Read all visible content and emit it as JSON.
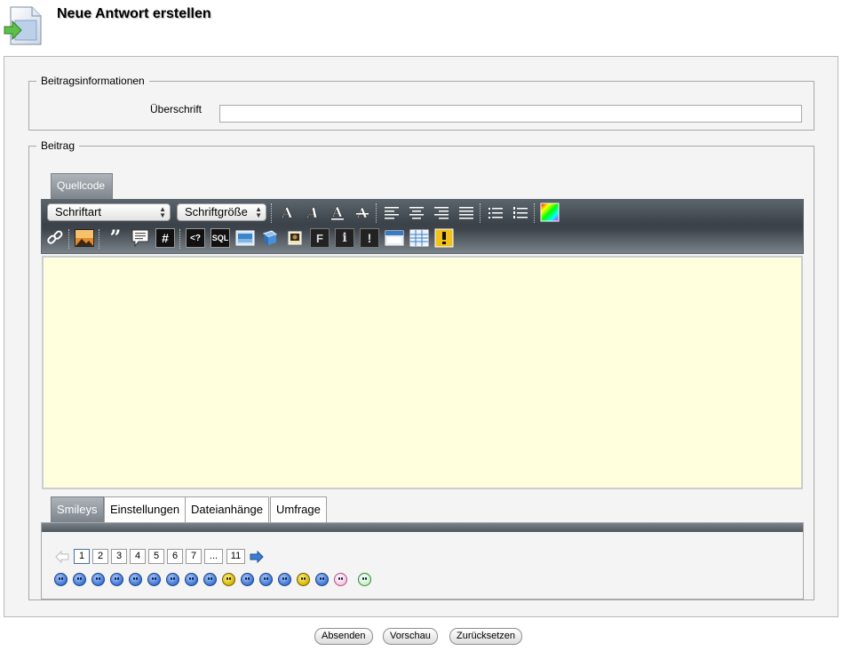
{
  "header": {
    "title": "Neue Antwort erstellen",
    "icon": "new-reply-document-icon"
  },
  "info_section": {
    "legend": "Beitragsinformationen",
    "headline_label": "Überschrift",
    "headline_value": ""
  },
  "post_section": {
    "legend": "Beitrag",
    "editor_tab": "Quellcode",
    "toolbar": {
      "font_select": "Schriftart",
      "size_select": "Schriftgröße",
      "buttons_row1": [
        "bold-icon",
        "italic-icon",
        "underline-icon",
        "strikethrough-icon",
        "align-left-icon",
        "align-center-icon",
        "align-right-icon",
        "align-justify-icon",
        "unordered-list-icon",
        "ordered-list-icon",
        "color-picker-icon"
      ],
      "buttons_row2": [
        "link-icon",
        "image-icon",
        "quote-icon",
        "comment-icon",
        "hash-icon",
        "php-code-icon",
        "sql-code-icon",
        "screen-icon",
        "book-icon",
        "photo-icon",
        "f-icon",
        "info-icon",
        "alert-icon",
        "window-icon",
        "table-icon",
        "warning-icon"
      ],
      "sql_label": "SQL",
      "php_label": "<?",
      "hash_label": "#",
      "quote_label": "”"
    },
    "body_value": "",
    "bottom_tabs": [
      "Smileys",
      "Einstellungen",
      "Dateianhänge",
      "Umfrage"
    ],
    "active_bottom_tab": "Smileys",
    "pager": {
      "pages": [
        "1",
        "2",
        "3",
        "4",
        "5",
        "6",
        "7",
        "...",
        "11"
      ],
      "current": "1"
    },
    "smiley_count": 17
  },
  "actions": {
    "submit": "Absenden",
    "preview": "Vorschau",
    "reset": "Zurücksetzen"
  }
}
